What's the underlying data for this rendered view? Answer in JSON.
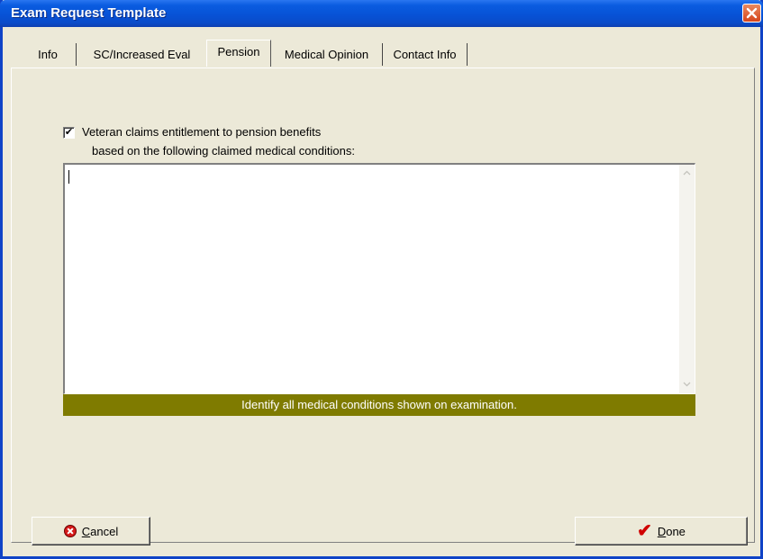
{
  "window": {
    "title": "Exam Request Template"
  },
  "tabs": [
    {
      "label": "Info"
    },
    {
      "label": "SC/Increased Eval"
    },
    {
      "label": "Pension",
      "active": true
    },
    {
      "label": "Medical Opinion"
    },
    {
      "label": "Contact Info"
    }
  ],
  "pension": {
    "checkbox_checked": true,
    "checkbox_mark": "✔",
    "label_line1": "Veteran claims entitlement to pension benefits",
    "label_line2": "based on the following claimed medical conditions:",
    "conditions_value": "",
    "hint": "Identify all medical conditions shown on examination.",
    "hint_color": "#7f7b00"
  },
  "buttons": {
    "cancel": {
      "accel": "C",
      "rest": "ancel",
      "icon": "cancel-icon"
    },
    "done": {
      "accel": "D",
      "rest": "one",
      "icon": "checkmark-icon",
      "icon_glyph": "✔"
    }
  },
  "colors": {
    "titlebar": "#0752d6",
    "close_button": "#d6451c",
    "face": "#ece9d8"
  }
}
